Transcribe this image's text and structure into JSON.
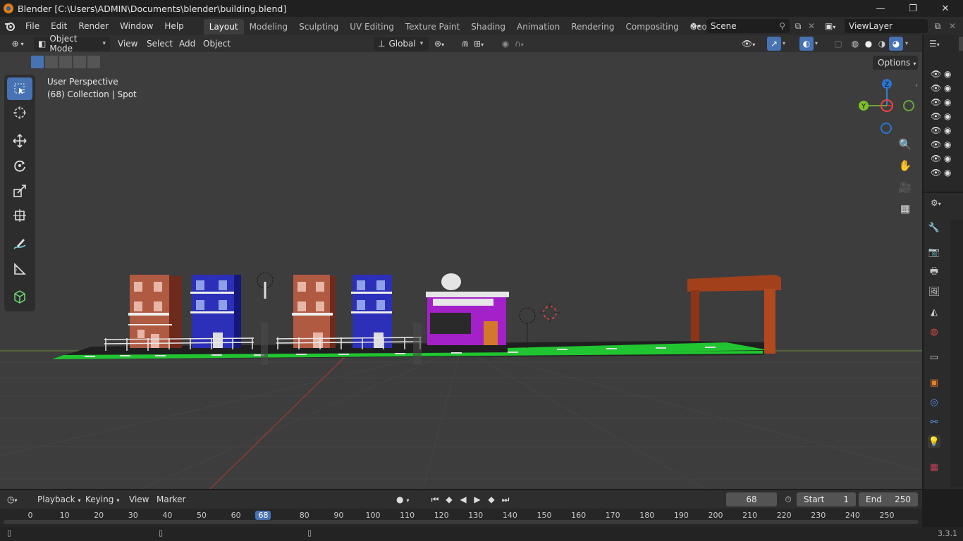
{
  "titlebar": {
    "title": "Blender [C:\\Users\\ADMIN\\Documents\\blender\\building.blend]",
    "minimize": "—",
    "maximize": "❐",
    "close": "✕"
  },
  "menubar": {
    "items": [
      "File",
      "Edit",
      "Render",
      "Window",
      "Help"
    ],
    "workspaces": [
      "Layout",
      "Modeling",
      "Sculpting",
      "UV Editing",
      "Texture Paint",
      "Shading",
      "Animation",
      "Rendering",
      "Compositing",
      "Geometry Noc"
    ],
    "active_workspace": "Layout",
    "scene": "Scene",
    "view_layer": "ViewLayer"
  },
  "viewport_header": {
    "mode": "Object Mode",
    "menus": [
      "View",
      "Select",
      "Add",
      "Object"
    ],
    "orientation": "Global",
    "options": "Options"
  },
  "viewport": {
    "perspective": "User Perspective",
    "collection": "(68) Collection | Spot",
    "gizmo": {
      "x": "X",
      "y": "Y",
      "z": "Z"
    }
  },
  "timeline": {
    "menus": [
      "Playback",
      "Keying",
      "View",
      "Marker"
    ],
    "current_frame": "68",
    "start_label": "Start",
    "start": "1",
    "end_label": "End",
    "end": "250",
    "ruler": [
      "0",
      "10",
      "20",
      "30",
      "40",
      "50",
      "60",
      "68",
      "80",
      "90",
      "100",
      "110",
      "120",
      "130",
      "140",
      "150",
      "160",
      "170",
      "180",
      "190",
      "200",
      "210",
      "220",
      "230",
      "240",
      "250"
    ]
  },
  "status": {
    "version": "3.3.1"
  },
  "colors": {
    "accent": "#4772b3",
    "viewport_bg": "#3d3d3d",
    "ground": "#21c431",
    "brick": "#b15a42",
    "blue_building": "#2c2fb8",
    "purple_shop": "#a420c8",
    "arch": "#a2401c"
  }
}
